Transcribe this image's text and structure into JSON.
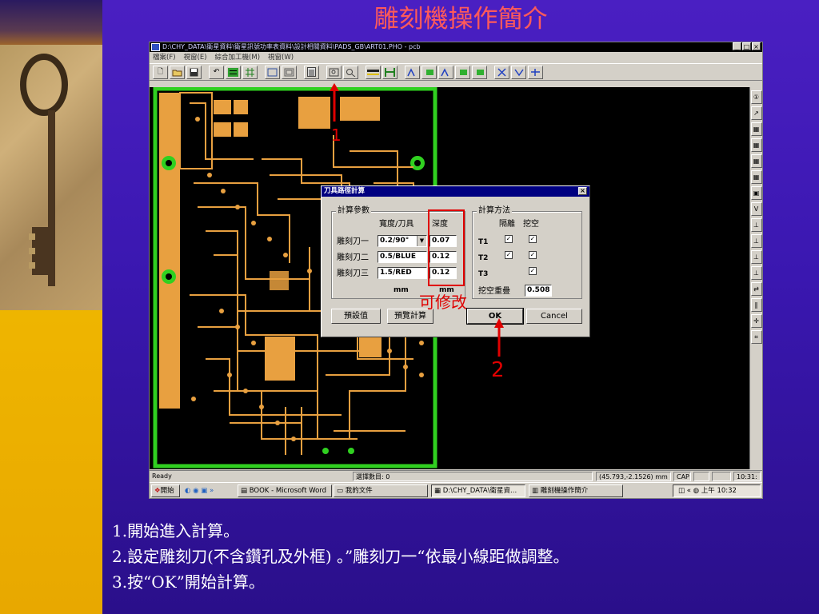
{
  "slide": {
    "title": "雕刻機操作簡介"
  },
  "app": {
    "title": "D:\\CHY_DATA\\衛星資料\\衛星訊號功率表資料\\設計相關資料\\PADS_GB\\ART01.PHO - pcb",
    "min_button": "_",
    "max_button": "□",
    "close_button": "×",
    "menu": [
      "檔案(F)",
      "視窗(E)",
      "綜合加工機(M)",
      "視窗(W)"
    ],
    "toolbar_icons": [
      "new-icon",
      "open-icon",
      "save-icon",
      "undo-icon",
      "layer-icon",
      "grid-icon",
      "zoom-box-icon",
      "zoom-window-icon",
      "calculator-icon",
      "zoom-in-icon",
      "zoom-fit-icon",
      "measure-icon",
      "route-icon",
      "t1-route-icon",
      "t1-fill-icon",
      "t2-route-icon",
      "t2-fill-icon",
      "t3-fill-icon",
      "drill-icon",
      "tool-t3-icon",
      "tool-combo-icon"
    ],
    "right_toolbar_icons": [
      "cursor-icon",
      "select-icon",
      "layer1-icon",
      "layer2-icon",
      "layer3-icon",
      "layer4-icon",
      "panel-icon",
      "v-icon",
      "dim1-icon",
      "dim2-icon",
      "dim3-icon",
      "dim4-icon",
      "swap-icon",
      "pause-icon",
      "cross-icon",
      "cnt-icon"
    ],
    "status": {
      "ready": "Ready",
      "selected": "選擇數目: 0",
      "coords": "(45.793,-2.1526) mm",
      "cap": "CAP",
      "time": "10:31:"
    },
    "taskbar": {
      "start": "開始",
      "tasks": [
        "BOOK - Microsoft Word",
        "我的文件",
        "D:\\CHY_DATA\\衛星資...",
        "雕刻機操作簡介"
      ],
      "clock": "上午 10:32"
    }
  },
  "dialog": {
    "title": "刀具路徑計算",
    "close": "×",
    "params_group": "計算參數",
    "col_width": "寬度/刀具",
    "col_depth": "深度",
    "tools": [
      {
        "label": "雕刻刀一",
        "width": "0.2/90°",
        "depth": "0.07"
      },
      {
        "label": "雕刻刀二",
        "width": "0.5/BLUE",
        "depth": "0.12"
      },
      {
        "label": "雕刻刀三",
        "width": "1.5/RED",
        "depth": "0.12"
      }
    ],
    "unit1": "mm",
    "unit2": "mm",
    "method_group": "計算方法",
    "col_isolate": "隔離",
    "col_clear": "挖空",
    "t_labels": [
      "T1",
      "T2",
      "T3"
    ],
    "checks": {
      "T1": {
        "isolate": "✓",
        "clear": "✓"
      },
      "T2": {
        "isolate": "✓",
        "clear": "✓"
      },
      "T3": {
        "clear": "✓"
      }
    },
    "overlap_label": "挖空重疊",
    "overlap_value": "0.508",
    "btn_default": "預設值",
    "btn_preview": "預覽計算",
    "btn_ok": "OK",
    "btn_cancel": "Cancel"
  },
  "annotations": {
    "editable": "可修改",
    "step1": "1",
    "step2": "2"
  },
  "caption": [
    "1.開始進入計算。",
    "2.設定雕刻刀(不含鑽孔及外框) 。”雕刻刀一“依最小線距做調整。",
    "3.按“OK”開始計算。"
  ],
  "colors": {
    "pcb_trace": "#e8a040",
    "pcb_outline": "#30d020",
    "background": "#000000",
    "highlight": "#e00000",
    "slide_bg": "#3a17b0"
  }
}
